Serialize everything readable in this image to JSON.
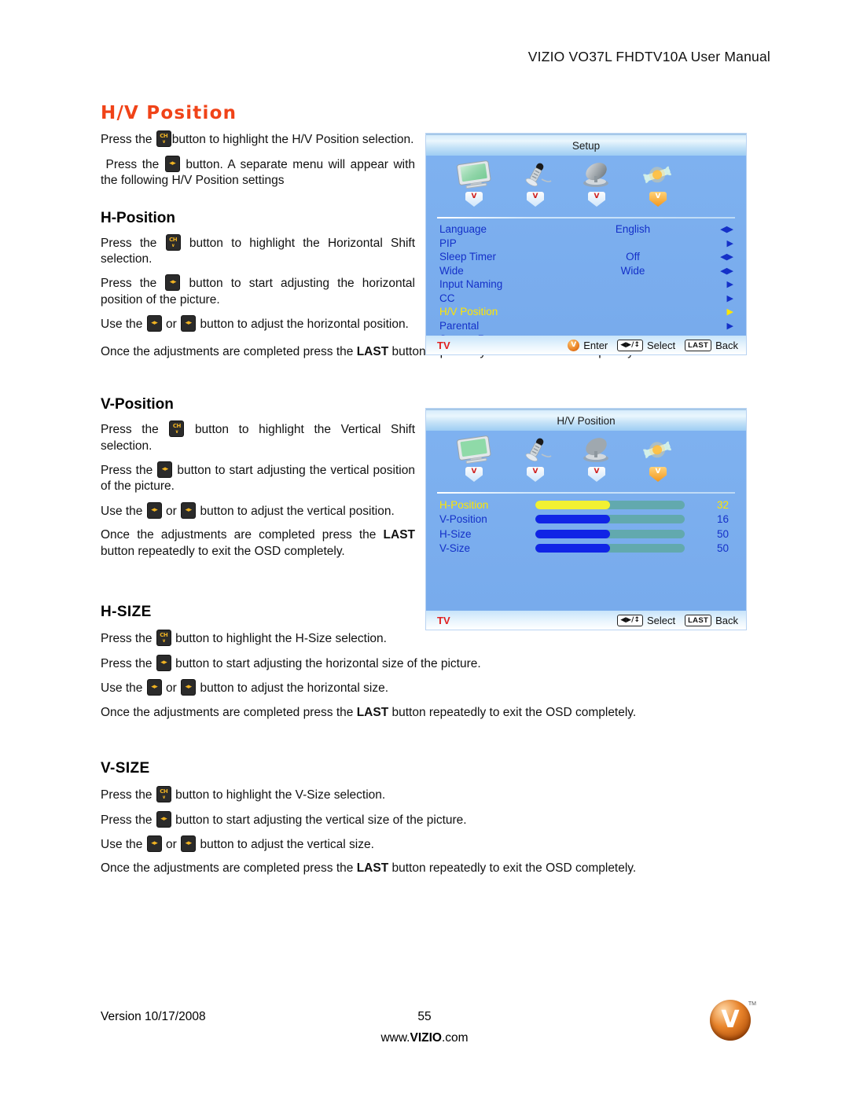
{
  "header": {
    "title": "VIZIO VO37L FHDTV10A User Manual"
  },
  "sections": {
    "hv_position": {
      "heading": "H/V Position",
      "p1_a": "Press the",
      "p1_b": "button to highlight the H/V Position selection.",
      "p2_a": "Press the",
      "p2_b": "button. A separate menu will appear with the following H/V Position settings"
    },
    "h_position": {
      "heading": "H-Position",
      "p1_a": "Press the",
      "p1_b": "button to highlight the Horizontal Shift selection.",
      "p2_a": "Press the",
      "p2_b": "button to start adjusting the horizontal position of the picture.",
      "p3_a": "Use the",
      "p3_or": "or",
      "p3_b": "button to adjust the horizontal position.",
      "p4_a": "Once the adjustments are completed press the",
      "p4_key": "LAST",
      "p4_b": "button repeatedly to exit the OSD completely."
    },
    "v_position": {
      "heading": "V-Position",
      "p1_a": "Press the",
      "p1_b": "button to highlight the Vertical Shift selection.",
      "p2_a": "Press the",
      "p2_b": "button to start adjusting the vertical position of the picture.",
      "p3_a": "Use the",
      "p3_or": "or",
      "p3_b": "button to adjust the vertical position.",
      "p4_a": "Once the adjustments are completed press the",
      "p4_key": "LAST",
      "p4_b": "button repeatedly to exit the OSD completely."
    },
    "h_size": {
      "heading": "H-SIZE",
      "p1_a": "Press the",
      "p1_b": "button to highlight the H-Size selection.",
      "p2_a": "Press the",
      "p2_b": "button to start adjusting the horizontal size of the picture.",
      "p3_a": "Use the",
      "p3_or": "or",
      "p3_b": "button to adjust the horizontal size.",
      "p4_a": "Once the adjustments are completed press the",
      "p4_key": "LAST",
      "p4_b": "button repeatedly to exit the OSD completely."
    },
    "v_size": {
      "heading": "V-SIZE",
      "p1_a": "Press the",
      "p1_b": "button to highlight the V-Size selection.",
      "p2_a": "Press the",
      "p2_b": "button to start adjusting the vertical size of the picture.",
      "p3_a": "Use the",
      "p3_or": "or",
      "p3_b": "button to adjust the vertical size.",
      "p4_a": "Once the adjustments are completed press the",
      "p4_key": "LAST",
      "p4_b": "button repeatedly to exit the OSD completely."
    }
  },
  "osd_setup": {
    "title": "Setup",
    "tabs": [
      {
        "icon": "monitor-icon",
        "active": false
      },
      {
        "icon": "microphone-icon",
        "active": false
      },
      {
        "icon": "satellite-dish-icon",
        "active": false
      },
      {
        "icon": "wrench-icon",
        "active": true
      }
    ],
    "rows": [
      {
        "label": "Language",
        "value": "English",
        "arrow": "◀▶",
        "selected": false
      },
      {
        "label": "PIP",
        "value": "",
        "arrow": "▶",
        "selected": false
      },
      {
        "label": "Sleep Timer",
        "value": "Off",
        "arrow": "◀▶",
        "selected": false
      },
      {
        "label": "Wide",
        "value": "Wide",
        "arrow": "◀▶",
        "selected": false
      },
      {
        "label": "Input Naming",
        "value": "",
        "arrow": "▶",
        "selected": false
      },
      {
        "label": "CC",
        "value": "",
        "arrow": "▶",
        "selected": false
      },
      {
        "label": "H/V Position",
        "value": "",
        "arrow": "▶",
        "selected": true
      },
      {
        "label": "Parental",
        "value": "",
        "arrow": "▶",
        "selected": false
      },
      {
        "label": "System Reset",
        "value": "",
        "arrow": "▶",
        "selected": false
      }
    ],
    "footer": {
      "source": "TV",
      "enter_label": "Enter",
      "enter_badge": "V",
      "select_label": "Select",
      "select_badge": "◀▶/↕",
      "back_label": "Back",
      "back_badge": "LAST"
    }
  },
  "osd_hv": {
    "title": "H/V Position",
    "tabs": [
      {
        "icon": "monitor-icon",
        "active": false
      },
      {
        "icon": "microphone-icon",
        "active": false
      },
      {
        "icon": "satellite-dish-icon",
        "active": false
      },
      {
        "icon": "wrench-icon",
        "active": true
      }
    ],
    "sliders": [
      {
        "label": "H-Position",
        "value": "32",
        "fill_pct": 50,
        "selected": true
      },
      {
        "label": "V-Position",
        "value": "16",
        "fill_pct": 50,
        "selected": false
      },
      {
        "label": "H-Size",
        "value": "50",
        "fill_pct": 50,
        "selected": false
      },
      {
        "label": "V-Size",
        "value": "50",
        "fill_pct": 50,
        "selected": false
      }
    ],
    "footer": {
      "source": "TV",
      "select_label": "Select",
      "select_badge": "◀▶/↕",
      "back_label": "Back",
      "back_badge": "LAST"
    }
  },
  "footer": {
    "version": "Version 10/17/2008",
    "page_number": "55",
    "website_prefix": "www.",
    "website_brand": "VIZIO",
    "website_suffix": ".com",
    "logo_letter": "V",
    "logo_tm": "TM"
  },
  "colors": {
    "heading_orange": "#f04318",
    "osd_blue": "#7fb2f0",
    "osd_text_blue": "#1430c8",
    "osd_highlight_yellow": "#ffe600",
    "osd_source_red": "#e02020",
    "slider_fill": "#1024e6",
    "slider_track": "#62a9ae"
  }
}
